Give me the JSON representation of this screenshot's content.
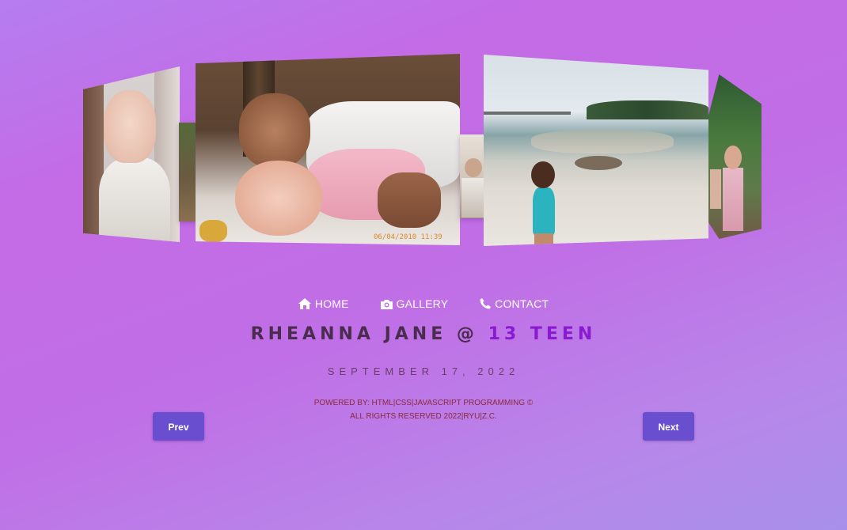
{
  "carousel": {
    "photos": [
      {
        "name": "baby-photo"
      },
      {
        "name": "siblings-photo",
        "stamp": "06/04/2010 11:39"
      },
      {
        "name": "small-photo"
      },
      {
        "name": "beach-photo"
      },
      {
        "name": "garden-photo"
      }
    ]
  },
  "nav": {
    "items": [
      {
        "label": "HOME",
        "icon": "home-icon"
      },
      {
        "label": "GALLERY",
        "icon": "camera-icon"
      },
      {
        "label": "CONTACT",
        "icon": "phone-icon"
      }
    ]
  },
  "title": {
    "part1": "RHEANNA JANE @ ",
    "part2": "13 TEEN"
  },
  "date": "SEPTEMBER 17, 2022",
  "footer": {
    "line1": "POWERED BY: HTML|CSS|JAVASCRIPT PROGRAMMING ©",
    "line2": "ALL RIGHTS RESERVED 2022|RYU|Z.C."
  },
  "buttons": {
    "prev": "Prev",
    "next": "Next"
  },
  "colors": {
    "accent": "#8a1ad0",
    "button": "#6a4ed0",
    "footer_text": "#8a2a3c"
  }
}
